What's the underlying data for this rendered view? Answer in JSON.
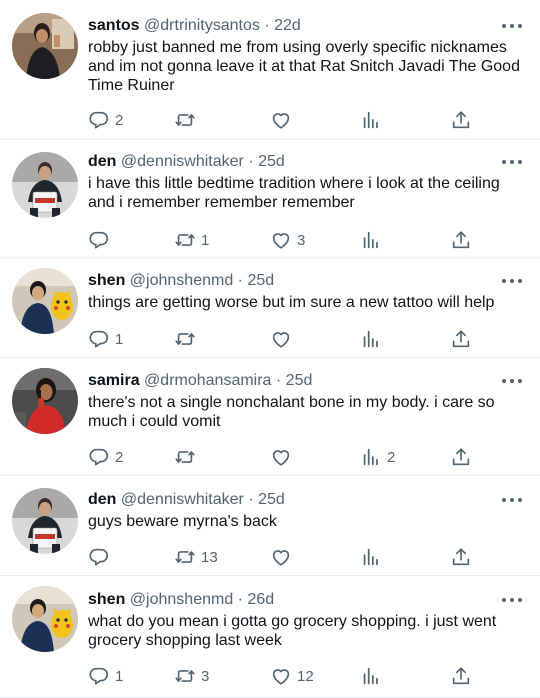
{
  "feed": {
    "tweets": [
      {
        "name": "santos",
        "handle": "@drtrinitysantos",
        "time": "22d",
        "text": "robby just banned me from using overly specific nicknames and im not gonna leave it at that Rat Snitch Javadi The Good Time Ruiner",
        "replies": "2",
        "retweets": "",
        "likes": "",
        "views": "",
        "avatar": "santos-avatar"
      },
      {
        "name": "den",
        "handle": "@denniswhitaker",
        "time": "25d",
        "text": "i have this little bedtime tradition where i look at the ceiling and i remember remember remember",
        "replies": "",
        "retweets": "1",
        "likes": "3",
        "views": "",
        "avatar": "den-avatar"
      },
      {
        "name": "shen",
        "handle": "@johnshenmd",
        "time": "25d",
        "text": "things are getting worse but im sure a new tattoo will help",
        "replies": "1",
        "retweets": "",
        "likes": "",
        "views": "",
        "avatar": "shen-avatar"
      },
      {
        "name": "samira",
        "handle": "@drmohansamira",
        "time": "25d",
        "text": "there's not a single nonchalant bone in my body. i care so much i could vomit",
        "replies": "2",
        "retweets": "",
        "likes": "",
        "views": "2",
        "avatar": "samira-avatar"
      },
      {
        "name": "den",
        "handle": "@denniswhitaker",
        "time": "25d",
        "text": "guys beware myrna's back",
        "replies": "",
        "retweets": "13",
        "likes": "",
        "views": "",
        "avatar": "den-avatar"
      },
      {
        "name": "shen",
        "handle": "@johnshenmd",
        "time": "26d",
        "text": "what do you mean i gotta go grocery shopping. i just went grocery shopping last week",
        "replies": "1",
        "retweets": "3",
        "likes": "12",
        "views": "",
        "avatar": "shen-avatar"
      }
    ],
    "separator": " · ",
    "colors": {
      "text": "#0f1419",
      "muted": "#536471",
      "divider": "#e6ecf0",
      "bucket_label": "#c0392b"
    },
    "icons": [
      "reply-icon",
      "retweet-icon",
      "like-icon",
      "views-icon",
      "share-icon",
      "more-icon"
    ]
  }
}
